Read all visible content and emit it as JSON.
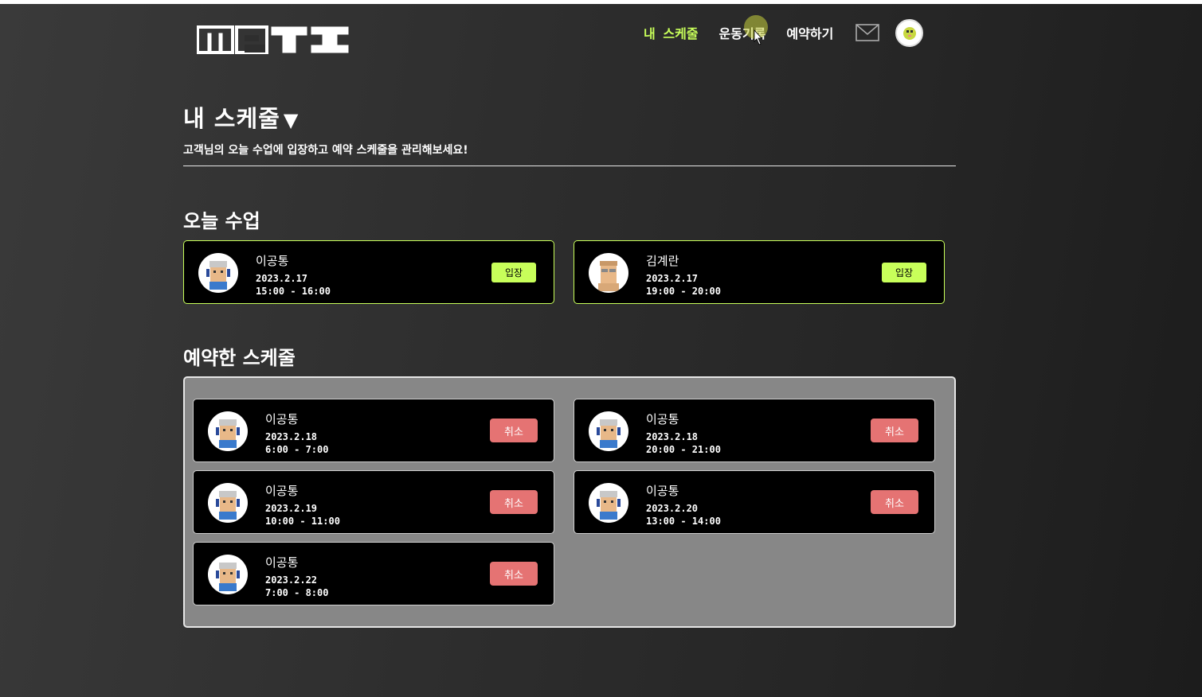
{
  "header": {
    "logo_text": "MPTI",
    "nav": [
      {
        "label": "내 스케줄",
        "active": true
      },
      {
        "label": "운동기록",
        "active": false
      },
      {
        "label": "예약하기",
        "active": false
      }
    ],
    "mail_icon": "mail-icon",
    "profile_icon": "avatar-icon"
  },
  "page": {
    "title": "내 스케줄",
    "title_arrow": "▼",
    "subtitle": "고객님의 오늘 수업에 입장하고 예약 스케줄을 관리해보세요!"
  },
  "today": {
    "title": "오늘 수업",
    "items": [
      {
        "name": "이공통",
        "date": "2023.2.17",
        "time": "15:00 - 16:00",
        "action": "입장"
      },
      {
        "name": "김계란",
        "date": "2023.2.17",
        "time": "19:00 - 20:00",
        "action": "입장"
      }
    ]
  },
  "booked": {
    "title": "예약한 스케줄",
    "items": [
      {
        "name": "이공통",
        "date": "2023.2.18",
        "time": "6:00 - 7:00",
        "action": "취소"
      },
      {
        "name": "이공통",
        "date": "2023.2.18",
        "time": "20:00 - 21:00",
        "action": "취소"
      },
      {
        "name": "이공통",
        "date": "2023.2.19",
        "time": "10:00 - 11:00",
        "action": "취소"
      },
      {
        "name": "이공통",
        "date": "2023.2.20",
        "time": "13:00 - 14:00",
        "action": "취소"
      },
      {
        "name": "이공통",
        "date": "2023.2.22",
        "time": "7:00 - 8:00",
        "action": "취소"
      }
    ]
  },
  "colors": {
    "accent": "#c8ff5a",
    "cancel": "#e57373",
    "panel": "#878787"
  }
}
